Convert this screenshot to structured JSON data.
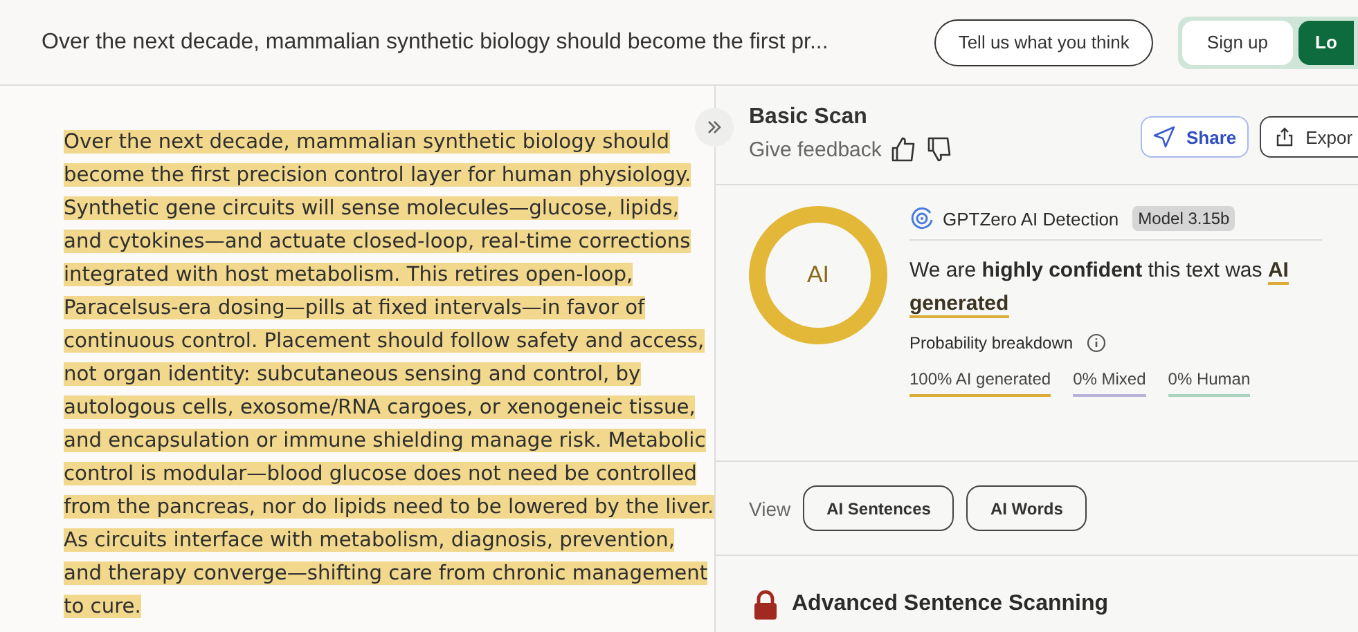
{
  "header": {
    "title": "Over the next decade, mammalian synthetic biology should become the first pr...",
    "feedback_button": "Tell us what you think",
    "signup_button": "Sign up",
    "login_button": "Lo"
  },
  "document": {
    "text": "Over the next decade, mammalian synthetic biology should become the first precision control layer for human physiology. Synthetic gene circuits will sense molecules—glucose, lipids, and cytokines—and actuate closed-loop, real-time corrections integrated with host metabolism. This retires open-loop, Paracelsus-era dosing—pills at fixed intervals—in favor of continuous control. Placement should follow safety and access, not organ identity: subcutaneous sensing and control, by autologous cells, exosome/RNA cargoes, or xenogeneic tissue, and encapsulation or immune shielding manage risk. Metabolic control is modular—blood glucose does not need be controlled from the pancreas, nor do lipids need to be lowered by the liver. As circuits interface with metabolism, diagnosis, prevention, and therapy converge—shifting care from chronic management to cure."
  },
  "scan": {
    "title": "Basic Scan",
    "feedback_label": "Give feedback",
    "share_button": "Share",
    "export_button": "Expor"
  },
  "result": {
    "ring": {
      "label": "AI",
      "level": 1
    },
    "detector": "GPTZero AI Detection",
    "model_badge": "Model 3.15b",
    "verdict": "We are **highly confident** this text was",
    "verdict_result": "AI generated",
    "breakdown_title": "Probability breakdown",
    "breakdown": [
      {
        "label": "100% AI generated",
        "color": "#d9ad38"
      },
      {
        "label": "0% Mixed",
        "color": "#b9b3dc"
      },
      {
        "label": "0% Human",
        "color": "#a9d3bd"
      }
    ]
  },
  "view": {
    "label": "View",
    "options": [
      {
        "label": "AI Sentences",
        "selected": false
      },
      {
        "label": "AI Words",
        "selected": false
      }
    ]
  },
  "advanced": {
    "title": "Advanced Sentence Scanning"
  }
}
